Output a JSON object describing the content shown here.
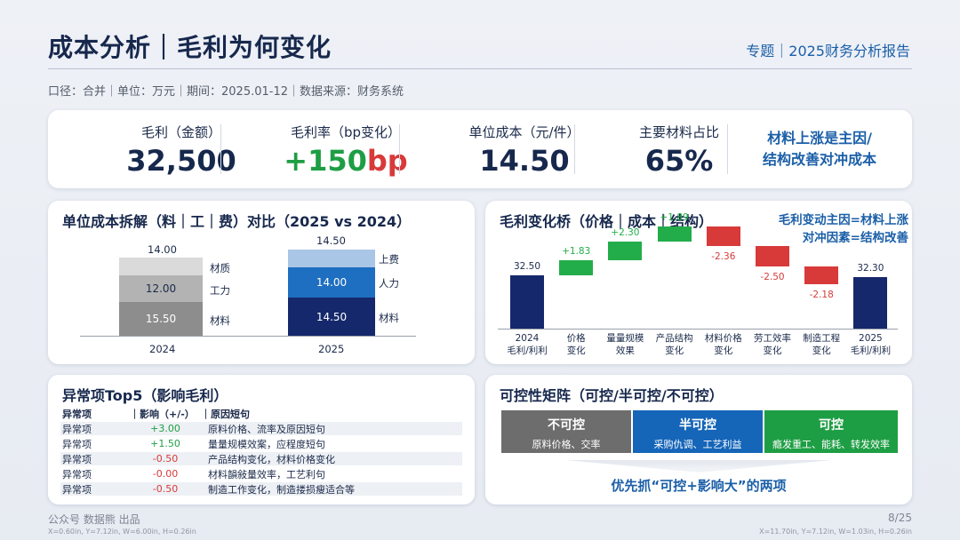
{
  "header": {
    "title": "成本分析｜毛利为何变化",
    "right": "专题｜2025财务分析报告",
    "subtitle": "口径：合并｜单位：万元｜期间：2025.01-12｜数据来源：财务系统"
  },
  "kpis": [
    {
      "label": "毛利（金额）",
      "value": "32,500",
      "color": "#17284d"
    },
    {
      "label": "毛利率（bp变化）",
      "value_plus": "+150",
      "value_unit": "bp"
    },
    {
      "label": "单位成本（元/件）",
      "value": "14.50",
      "color": "#17284d"
    },
    {
      "label": "主要材料占比",
      "value": "65%",
      "color": "#17284d"
    }
  ],
  "kpi_note": [
    "材料上涨是主因/",
    "结构改善对冲成本"
  ],
  "unit_cost": {
    "title": "单位成本拆解（料｜工｜费）对比（2025 vs 2024）",
    "bars": [
      {
        "year": "2024",
        "total": "14.00",
        "segments": [
          {
            "name": "材料",
            "value": "15.50",
            "color": "#8d8d8d"
          },
          {
            "name": "工力",
            "value": "12.00",
            "color": "#b3b3b3"
          },
          {
            "name": "材质",
            "value": "",
            "color": "#dadada"
          }
        ]
      },
      {
        "year": "2025",
        "total": "14.50",
        "segments": [
          {
            "name": "材料",
            "value": "14.50",
            "color": "#15286b"
          },
          {
            "name": "人力",
            "value": "14.00",
            "color": "#1e6ec1"
          },
          {
            "name": "上费",
            "value": "",
            "color": "#a9c6e6"
          }
        ]
      }
    ]
  },
  "waterfall": {
    "title": "毛利变化桥（价格｜成本｜结构）",
    "note": [
      "毛利变动主因=材料上涨",
      "对冲因素=结构改善"
    ],
    "colors": {
      "total": "#15286b",
      "up": "#22ad4a",
      "down": "#d83a3a"
    }
  },
  "chart_data": {
    "type": "bar",
    "title": "毛利变化桥（价格｜成本｜结构）",
    "categories": [
      "2024\n毛利/利利",
      "价格\n变化",
      "量量规模\n效果",
      "产品结构\n变化",
      "材料价格\n变化",
      "劳工效率\n变化",
      "制造工程\n变化",
      "2025\n毛利/利利"
    ],
    "values": [
      32.5,
      1.83,
      2.3,
      1.89,
      -2.36,
      -2.5,
      -2.18,
      32.3
    ],
    "labels": [
      "32.50",
      "+1.83",
      "+2.30",
      "+1.89",
      "-2.36",
      "-2.50",
      "-2.18",
      "32.30"
    ],
    "kinds": [
      "total",
      "up",
      "up",
      "up",
      "down",
      "down",
      "down",
      "total"
    ]
  },
  "anomalies": {
    "title": "异常项Top5（影响毛利）",
    "headers": [
      "异常项",
      "｜影响（+/-）",
      "｜原因短句"
    ],
    "rows": [
      {
        "item": "异常项",
        "impact": "+3.00",
        "reason": "原料价格、流率及原因短句"
      },
      {
        "item": "异常项",
        "impact": "+1.50",
        "reason": "量量规模效案，应程度短句"
      },
      {
        "item": "异常项",
        "impact": "-0.50",
        "reason": "产品结构变化，材料价格变化"
      },
      {
        "item": "异常项",
        "impact": "-0.00",
        "reason": "材料韻敍量效率，工艺利句"
      },
      {
        "item": "异常项",
        "impact": "-0.50",
        "reason": "制造工作变化，制造搂损瘦适合等"
      }
    ]
  },
  "matrix": {
    "title": "可控性矩阵（可控/半可控/不可控）",
    "cells": [
      {
        "title": "不可控",
        "sub": "原料价格、交率",
        "color": "#6d6d6d"
      },
      {
        "title": "半可控",
        "sub": "采购仇调、工艺利益",
        "color": "#1565b8"
      },
      {
        "title": "可控",
        "sub": "瘾发重工、能耗、转发效率",
        "color": "#1e9e44"
      }
    ],
    "conclusion": "优先抓“可控+影响大”的两项"
  },
  "footer": {
    "left": "公众号 数据熊 出品",
    "right": "8/25",
    "coord_left": "X=0.60in, Y=7.12in, W=6.00in, H=0.26in",
    "coord_right": "X=11.70in, Y=7.12in, W=1.03in, H=0.26in"
  }
}
